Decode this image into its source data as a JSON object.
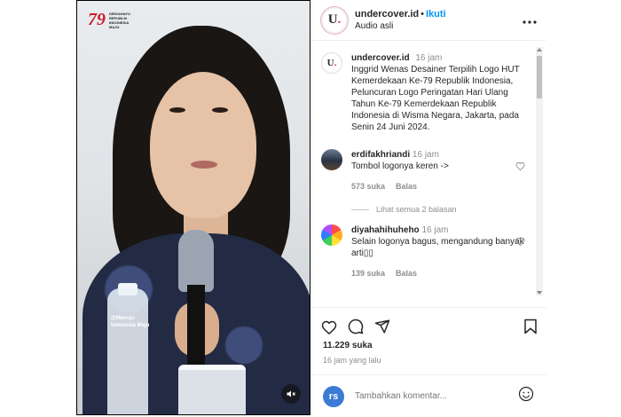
{
  "media": {
    "brand_number": "79",
    "brand_lines": [
      "DIRGAHAYU",
      "REPUBLIK",
      "INDONESIA",
      "MAJU"
    ],
    "overlay_tag_lines": [
      "@Menuju",
      "Indonesia Maju"
    ]
  },
  "post": {
    "username": "undercover.id",
    "separator": "•",
    "follow_label": "Ikuti",
    "audio": "Audio asli"
  },
  "caption": {
    "username": "undercover.id",
    "time": "16 jam",
    "text": "Inggrid Wenas Desainer Terpilih Logo HUT Kemerdekaan Ke-79 Republik Indonesia, Peluncuran Logo Peringatan Hari Ulang Tahun Ke-79 Kemerdekaan Republik Indonesia di Wisma Negara, Jakarta, pada Senin 24 Juni 2024."
  },
  "comments": [
    {
      "username": "erdifakhriandi",
      "time": "16 jam",
      "text": "Tombol logonya keren ->",
      "likes": "573 suka",
      "reply_label": "Balas",
      "view_replies": "Lihat semua 2 balasan"
    },
    {
      "username": "diyahahihuheho",
      "time": "16 jam",
      "text": "Selain logonya bagus, mengandung banyak arti▯▯",
      "likes": "139 suka",
      "reply_label": "Balas"
    }
  ],
  "stats": {
    "likes": "11.229 suka",
    "posted_ago": "16 jam yang lalu"
  },
  "composer": {
    "avatar_initials": "rs",
    "placeholder": "Tambahkan komentar..."
  },
  "icons": {
    "heart": "heart-icon",
    "comment": "comment-icon",
    "share": "send-icon",
    "save": "bookmark-icon",
    "emoji": "emoji-icon",
    "mute": "speaker-muted-icon",
    "more": "more-options-icon"
  },
  "colors": {
    "accent": "#0095f6",
    "brand_red": "#c8202b",
    "muted_text": "#8e8e8e"
  }
}
